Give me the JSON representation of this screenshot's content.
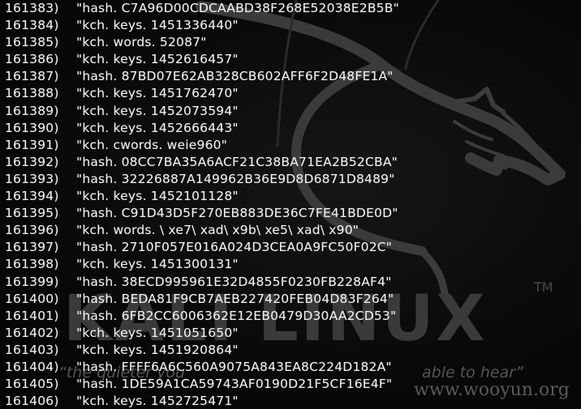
{
  "terminal": {
    "lines": [
      {
        "num": "161383)",
        "value": "\"hash. C7A96D00CDCAABD38F268E52038E2B5B\""
      },
      {
        "num": "161384)",
        "value": "\"kch. keys. 1451336440\""
      },
      {
        "num": "161385)",
        "value": "\"kch. words. 52087\""
      },
      {
        "num": "161386)",
        "value": "\"kch. keys. 1452616457\""
      },
      {
        "num": "161387)",
        "value": "\"hash. 87BD07E62AB328CB602AFF6F2D48FE1A\""
      },
      {
        "num": "161388)",
        "value": "\"kch. keys. 1451762470\""
      },
      {
        "num": "161389)",
        "value": "\"kch. keys. 1452073594\""
      },
      {
        "num": "161390)",
        "value": "\"kch. keys. 1452666443\""
      },
      {
        "num": "161391)",
        "value": "\"kch. cwords. weie960\""
      },
      {
        "num": "161392)",
        "value": "\"hash. 08CC7BA35A6ACF21C38BA71EA2B52CBA\""
      },
      {
        "num": "161393)",
        "value": "\"hash. 32226887A149962B36E9D8D6871D8489\""
      },
      {
        "num": "161394)",
        "value": "\"kch. keys. 1452101128\""
      },
      {
        "num": "161395)",
        "value": "\"hash. C91D43D5F270EB883DE36C7FE41BDE0D\""
      },
      {
        "num": "161396)",
        "value": "\"kch. words. \\ xe7\\ xad\\ x9b\\ xe5\\ xad\\ x90\""
      },
      {
        "num": "161397)",
        "value": "\"hash. 2710F057E016A024D3CEA0A9FC50F02C\""
      },
      {
        "num": "161398)",
        "value": "\"kch. keys. 1451300131\""
      },
      {
        "num": "161399)",
        "value": "\"hash. 38ECD995961E32D4855F0230FB228AF4\""
      },
      {
        "num": "161400)",
        "value": "\"hash. BEDA81F9CB7AEB227420FEB04D83F264\""
      },
      {
        "num": "161401)",
        "value": "\"hash. 6FB2CC6006362E12EB0479D30AA2CD53\""
      },
      {
        "num": "161402)",
        "value": "\"kch. keys. 1451051650\""
      },
      {
        "num": "161403)",
        "value": "\"kch. keys. 1451920864\""
      },
      {
        "num": "161404)",
        "value": "\"hash. FFFF6A6C560A9075A843EA8C224D182A\""
      },
      {
        "num": "161405)",
        "value": "\"hash. 1DE59A1CA59743AF0190D21F5CF16E4F\""
      },
      {
        "num": "161406)",
        "value": "\"kch. keys. 1452725471\""
      }
    ]
  },
  "wallpaper": {
    "brand": "KALI LINUX",
    "trademark": "TM",
    "slogan_left": "“the quieter you",
    "slogan_right": "able to hear”",
    "watermark_url": "www.wooyun.org"
  },
  "colors": {
    "text": "#f2f2f2",
    "background": "#050505",
    "dragon": "#3a3a3a"
  }
}
